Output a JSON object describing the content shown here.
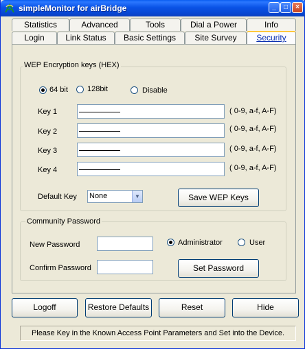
{
  "window": {
    "title": "simpleMonitor for airBridge",
    "controls": {
      "minimize": "_",
      "maximize": "□",
      "close": "×"
    }
  },
  "tabs_row1": [
    {
      "label": "Statistics"
    },
    {
      "label": "Advanced"
    },
    {
      "label": "Tools"
    },
    {
      "label": "Dial a Power"
    },
    {
      "label": "Info"
    }
  ],
  "tabs_row2": [
    {
      "label": "Login"
    },
    {
      "label": "Link Status"
    },
    {
      "label": "Basic Settings"
    },
    {
      "label": "Site Survey"
    },
    {
      "label": "Security",
      "active": true
    }
  ],
  "wep": {
    "group_title": "WEP Encryption keys (HEX)",
    "options": [
      {
        "label": "64 bit",
        "checked": true
      },
      {
        "label": "128bit",
        "checked": false
      },
      {
        "label": "Disable",
        "checked": false
      }
    ],
    "keys": [
      {
        "label": "Key 1",
        "value": "",
        "hint": "( 0-9, a-f, A-F)"
      },
      {
        "label": "Key 2",
        "value": "",
        "hint": "( 0-9, a-f, A-F)"
      },
      {
        "label": "Key 3",
        "value": "",
        "hint": "( 0-9, a-f, A-F)"
      },
      {
        "label": "Key 4",
        "value": "",
        "hint": "( 0-9, a-f, A-F)"
      }
    ],
    "default_key_label": "Default Key",
    "default_key_value": "None",
    "save_button": "Save WEP Keys"
  },
  "community": {
    "group_title": "Community Password",
    "new_password_label": "New Password",
    "confirm_password_label": "Confirm Password",
    "new_password_value": "",
    "confirm_password_value": "",
    "roles": [
      {
        "label": "Administrator",
        "checked": true
      },
      {
        "label": "User",
        "checked": false
      }
    ],
    "set_button": "Set Password"
  },
  "footer": {
    "logoff": "Logoff",
    "restore": "Restore Defaults",
    "reset": "Reset",
    "hide": "Hide"
  },
  "status": "Please Key in the Known Access Point Parameters and Set into the Device.",
  "colors": {
    "title_bar": "#0a53e6",
    "active_tab_accent": "#ffc83c",
    "window_bg": "#ece9d8"
  }
}
